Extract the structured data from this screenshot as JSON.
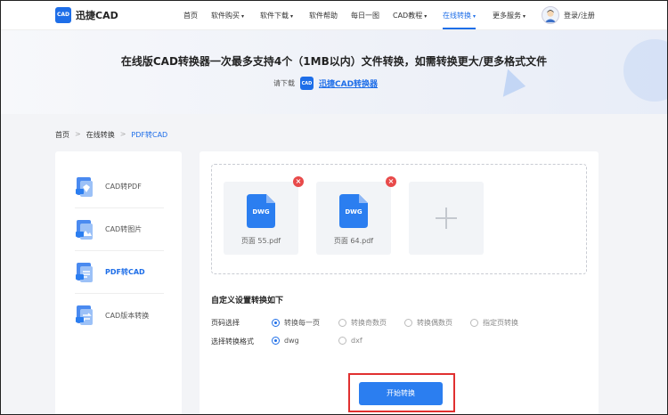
{
  "header": {
    "logo_mark": "CAD",
    "logo_text": "迅捷CAD",
    "nav": [
      {
        "label": "首页",
        "dropdown": false,
        "active": false
      },
      {
        "label": "软件购买",
        "dropdown": true,
        "active": false
      },
      {
        "label": "软件下载",
        "dropdown": true,
        "active": false
      },
      {
        "label": "软件帮助",
        "dropdown": false,
        "active": false
      },
      {
        "label": "每日一图",
        "dropdown": false,
        "active": false
      },
      {
        "label": "CAD教程",
        "dropdown": true,
        "active": false
      },
      {
        "label": "在线转换",
        "dropdown": true,
        "active": true
      },
      {
        "label": "更多服务",
        "dropdown": true,
        "active": false
      }
    ],
    "login_label": "登录/注册"
  },
  "banner": {
    "title": "在线版CAD转换器一次最多支持4个（1MB以内）文件转换，如需转换更大/更多格式文件",
    "sub_prefix": "请下载",
    "mini_logo": "CAD",
    "link_label": "迅捷CAD转换器"
  },
  "breadcrumb": {
    "home": "首页",
    "sep": ">",
    "section": "在线转换",
    "current": "PDF转CAD"
  },
  "sidebar": {
    "items": [
      {
        "label": "CAD转PDF",
        "active": false
      },
      {
        "label": "CAD转图片",
        "active": false
      },
      {
        "label": "PDF转CAD",
        "active": true
      },
      {
        "label": "CAD版本转换",
        "active": false
      }
    ]
  },
  "files": [
    {
      "badge": "DWG",
      "name": "页面 55.pdf",
      "delete_glyph": "×"
    },
    {
      "badge": "DWG",
      "name": "页面 64.pdf",
      "delete_glyph": "×"
    }
  ],
  "options": {
    "title": "自定义设置转换如下",
    "page_label": "页码选择",
    "page_options": [
      "转换每一页",
      "转换奇数页",
      "转换偶数页",
      "指定页转换"
    ],
    "page_selected": 0,
    "format_label": "选择转换格式",
    "format_options": [
      "dwg",
      "dxf"
    ],
    "format_selected": 0
  },
  "actions": {
    "start_label": "开始转换"
  },
  "colors": {
    "accent": "#1e6ee8",
    "button": "#2b7ef0",
    "highlight_border": "#e03030",
    "delete": "#e84a4a"
  }
}
